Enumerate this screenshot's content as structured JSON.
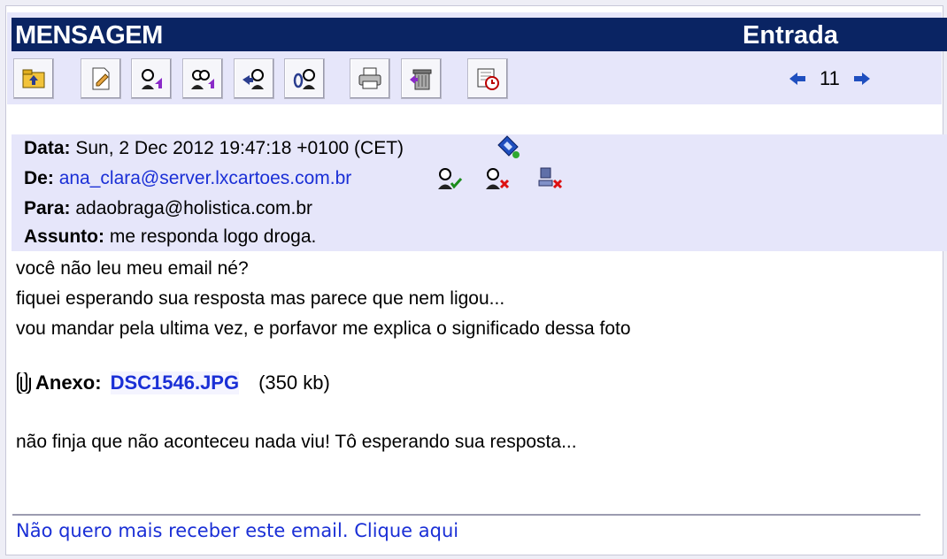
{
  "header": {
    "title": "MENSAGEM",
    "folder": "Entrada"
  },
  "toolbar": {
    "buttons": [
      {
        "icon": "folder-up-icon"
      },
      {
        "icon": "compose-icon"
      },
      {
        "icon": "reply-icon"
      },
      {
        "icon": "reply-all-icon"
      },
      {
        "icon": "forward-icon"
      },
      {
        "icon": "forward-attachment-icon"
      },
      {
        "icon": "print-icon"
      },
      {
        "icon": "trash-icon"
      },
      {
        "icon": "schedule-icon"
      }
    ]
  },
  "pager": {
    "current": "11"
  },
  "message": {
    "date_label": "Data:",
    "date_value": "Sun, 2 Dec 2012 19:47:18 +0100 (CET)",
    "from_label": "De:",
    "from_value": "ana_clara@server.lxcartoes.com.br",
    "to_label": "Para:",
    "to_value": "adaobraga@holistica.com.br",
    "subject_label": "Assunto:",
    "subject_value": "me responda logo droga.",
    "body_lines": [
      "você não leu meu email né?",
      "fiquei esperando sua resposta mas parece que nem ligou...",
      "vou mandar pela ultima vez, e porfavor me explica o significado dessa foto"
    ],
    "attachment_label": "Anexo:",
    "attachment_name": "DSC1546.JPG",
    "attachment_size": "(350 kb)",
    "closing_line": "não finja que não aconteceu nada viu! Tô esperando sua resposta...",
    "unsubscribe": "Não quero mais receber este email. Clique aqui"
  },
  "colors": {
    "titlebar": "#0a2463",
    "band": "#e6e6fa",
    "link": "#1a2fd6"
  }
}
